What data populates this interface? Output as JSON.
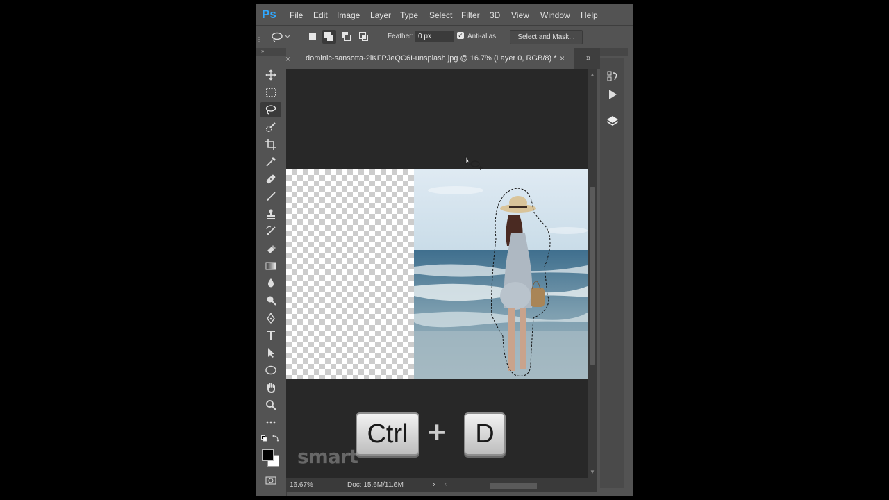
{
  "app": {
    "logo": "Ps"
  },
  "menu": [
    "File",
    "Edit",
    "Image",
    "Layer",
    "Type",
    "Select",
    "Filter",
    "3D",
    "View",
    "Window",
    "Help"
  ],
  "options": {
    "feather_label": "Feather:",
    "feather_value": "0 px",
    "antialias_label": "Anti-alias",
    "antialias_checked": true,
    "select_mask_label": "Select and Mask..."
  },
  "document": {
    "tab_title": "dominic-sansotta-2iKFPJeQC6I-unsplash.jpg @ 16.7% (Layer 0, RGB/8) *",
    "close_glyph": "×"
  },
  "status": {
    "zoom": "16.67%",
    "doc_size": "Doc: 15.6M/11.6M"
  },
  "overlay": {
    "key1": "Ctrl",
    "plus": "+",
    "key2": "D",
    "watermark": "smart"
  },
  "tools": [
    "move-tool",
    "marquee-tool",
    "lasso-tool",
    "quick-selection-tool",
    "crop-tool",
    "eyedropper-tool",
    "healing-brush-tool",
    "brush-tool",
    "clone-stamp-tool",
    "history-brush-tool",
    "eraser-tool",
    "gradient-tool",
    "blur-tool",
    "dodge-tool",
    "pen-tool",
    "type-tool",
    "path-selection-tool",
    "ellipse-tool",
    "hand-tool",
    "zoom-tool",
    "more-tools"
  ],
  "colors": {
    "accent": "#31a8ff",
    "foreground": "#000000",
    "background": "#ffffff"
  }
}
